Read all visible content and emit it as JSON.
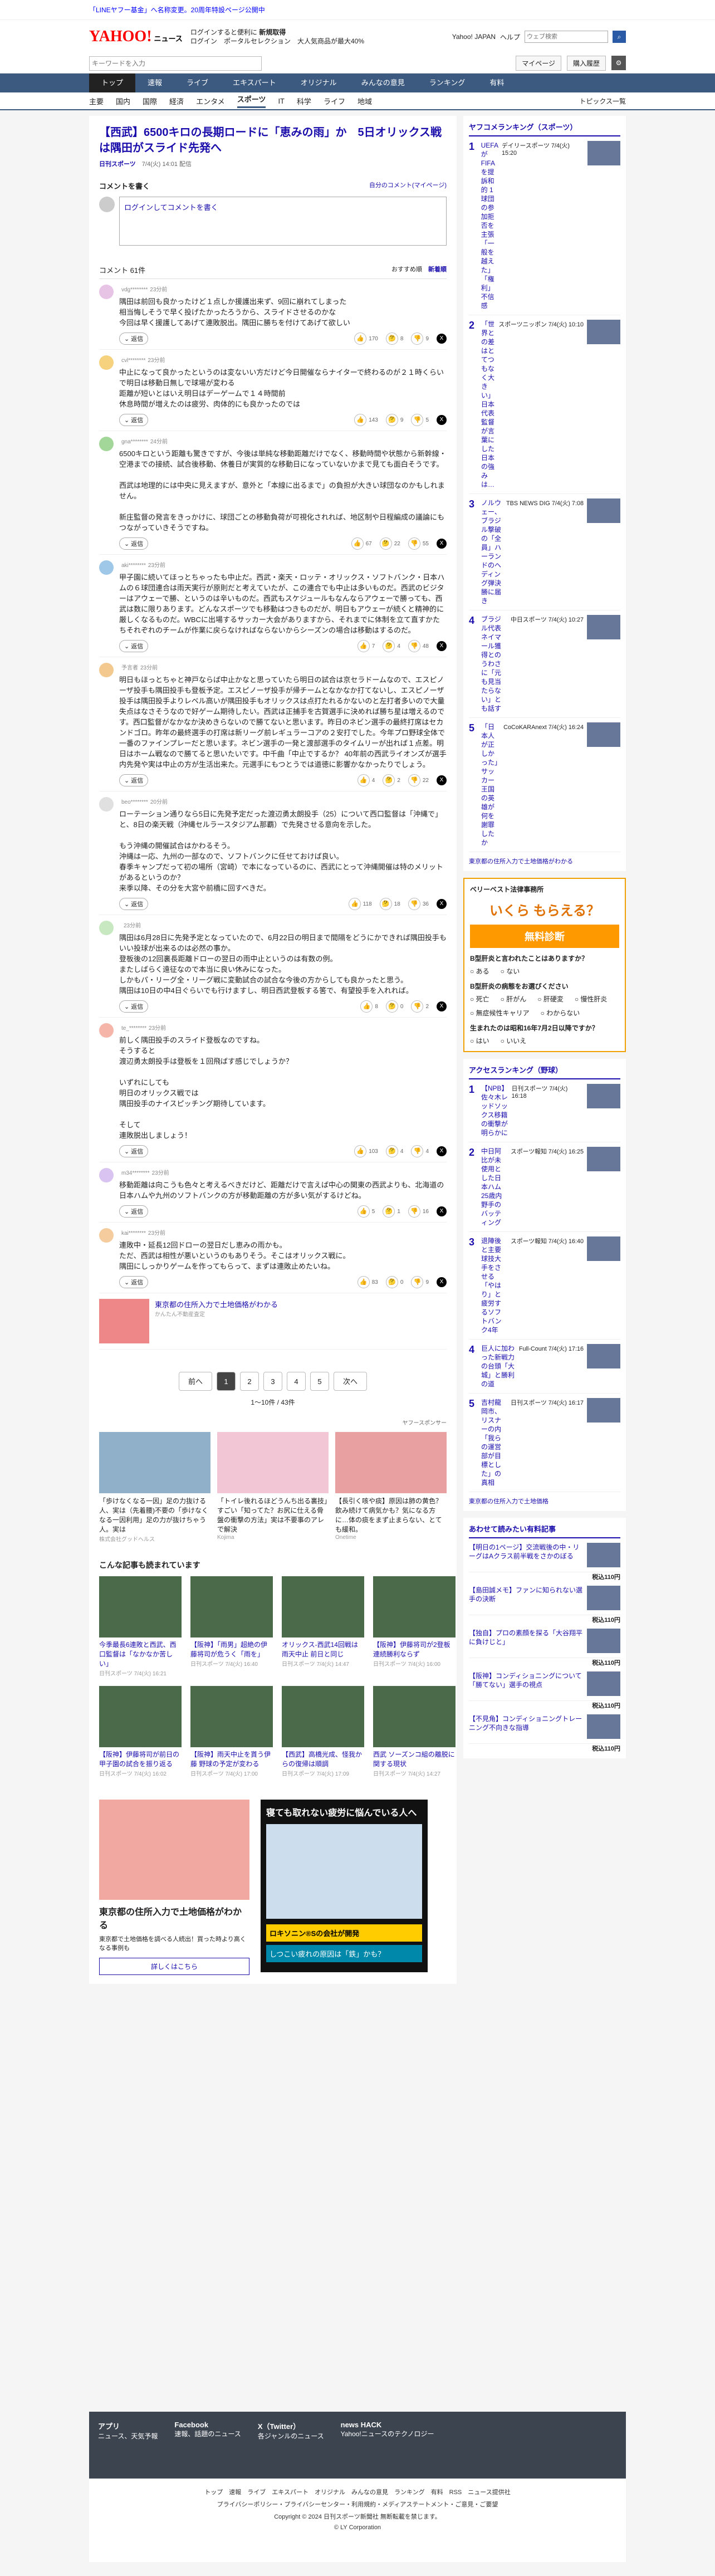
{
  "top_notice": "「LINEヤフー基金」へ名称変更。20周年特設ページ公開中",
  "header": {
    "logo": "YAHOO!",
    "logo_sub": "ニュース",
    "links": [
      "ログインすると便利に",
      "ログイン",
      "ポータルセレクション",
      "大人気商品が最大40%"
    ],
    "bold_link": "新規取得",
    "right": [
      "Yahoo! JAPAN",
      "ヘルプ"
    ],
    "search_placeholder": "ウェブ検索",
    "search_btn": "検索"
  },
  "searchrow": {
    "placeholder": "キーワードを入力",
    "mypage": "マイページ",
    "buy": "購入履歴"
  },
  "categories": [
    "トップ",
    "速報",
    "ライブ",
    "エキスパート",
    "オリジナル",
    "みんなの意見",
    "ランキング",
    "有料"
  ],
  "subnav": [
    "主要",
    "国内",
    "国際",
    "経済",
    "エンタメ",
    "スポーツ",
    "IT",
    "科学",
    "ライフ",
    "地域"
  ],
  "subnav_right": "トピックス一覧",
  "article": {
    "title": "【西武】6500キロの長期ロードに「恵みの雨」か　5日オリックス戦は隅田がスライド先発へ",
    "source": "日刊スポーツ",
    "date": "7/4(火) 14:01 配信"
  },
  "comment_write": {
    "label": "コメントを書く",
    "manage": "自分のコメント(マイページ)",
    "placeholder": "ログインしてコメントを書く"
  },
  "comment_head": {
    "count": "コメント 61件",
    "sort1": "おすすめ順",
    "sort2": "新着順"
  },
  "comments": [
    {
      "user": "vdg********",
      "time": "23分前",
      "text": "隅田は前回も良かったけど１点しか援護出来ず、9回に崩れてしまった\n相当悔しそうで早く投げたかったろうから、スライドさせるのかな\n今回は早く援護してあげて連敗脱出。隅田に勝ちを付けてあげて欲しい",
      "likes": "170",
      "neutral": "8",
      "dis": "9",
      "color": "#e7c3e5"
    },
    {
      "user": "cvl********",
      "time": "23分前",
      "text": "中止になって良かったというのは変ないい方だけど今日開催ならナイターで終わるのが２１時くらいで明日は移動日無しで球場が変わる\n距離が短いとはいえ明日はデーゲームで１４時間前\n休息時間が増えたのは疲労、肉体的にも良かったのでは",
      "likes": "143",
      "neutral": "9",
      "dis": "5",
      "color": "#f6d27e"
    },
    {
      "user": "gna********",
      "time": "24分前",
      "text": "6500キロという距離も驚きですが、今後は単純な移動距離だけでなく、移動時間や状態から新幹線・空港までの接続、試合後移動、休養日が実質的な移動日になっていないかまで見ても面白そうです。\n\n西武は地理的には中央に見えますが、意外と「本線に出るまで」の負担が大きい球団なのかもしれません。\n\n新庄監督の発言をきっかけに、球団ごとの移動負荷が可視化されれば、地区制や日程編成の議論にもつながっていきそうですね。",
      "likes": "67",
      "neutral": "22",
      "dis": "55",
      "color": "#a3d79a"
    },
    {
      "user": "aki********",
      "time": "23分前",
      "text": "甲子園に続いてほっとちゃったも中止だ。西武・楽天・ロッテ・オリックス・ソフトバンク・日本ハムの６球団連合は雨天実行が原則だと考えていたが、この連合でも中止は多いものだ。西武のビジターはアウェーで勝、というのは辛いものだ。西武もスケジュールもなんならアウェーで勝っても、西武は数に限りあります。どんなスポーツでも移動はつきものだが、明日もアウェーが続くと精神的に厳しくなるものだ。WBCに出場するサッカー大会がありますから、それまでに体制を立て直すかたちそれぞれのチームが作業に戻らなければならないからシーズンの場合は移動はするのだ。",
      "likes": "7",
      "neutral": "4",
      "dis": "48",
      "color": "#9fc8e8"
    },
    {
      "user": "予言者",
      "time": "23分前",
      "text": "明日もほっとちゃと神戸ならば中止かなと思っていたら明日の試合は京セラドームなので、エスピノーザ投手も隅田投手も登板予定。エスピノーザ投手が帰チームとなかなか打てないし、エスピノーザ投手は隅田投手よりレベル高いが隅田投手もオリックスは点打たれるかないのと左打者多いので大量失点はなさそうなので好ゲーム期待したい。西武は正捕手を古賀選手に決めれば勝ち星は増えるのです。西口監督がなかなか決めきらないので勝てないと思います。昨日のネビン選手の最終打席はセカンドゴロ。昨年の最終選手の打席は新リーグ前レギュラーコアの２安打でした。今年プロ野球全体で一番のファインプレーだと思います。ネビン選手の一発と渡部選手のタイムリーが出れば１点差。明日はホーム戦なので勝てると思いたいです。中千曲「中止でするか？ 40年前の西武ライオンズが選手内先発や実は中止の方が生活出来た。元選手にもつとうでは道徳に影響かなかったりでしょう。",
      "likes": "4",
      "neutral": "2",
      "dis": "22",
      "color": "#f3c98f"
    },
    {
      "user": "beo********",
      "time": "20分前",
      "text": "ローテーション通りなら5日に先発予定だった渡辺勇太朗投手（25）について西口監督は「沖縄で」と、8日の楽天戦（沖縄セルラースタジアム那覇）で先発させる意向を示した。\n\nもう沖縄の開催試合はかわるそう。\n沖縄は一応、九州の一部なので、ソフトバンクに任せておけば良い。\n春季キャンプだって初の場所（宮崎）で本になっているのに、西武にとって沖縄開催は特のメリットがあるというのか？\n来季以降、その分を大宮や前橋に回すべきだ。",
      "likes": "118",
      "neutral": "18",
      "dis": "36",
      "color": "#e0e0e0"
    },
    {
      "user": "",
      "time": "23分前",
      "text": "隅田は6月28日に先発予定となっていたので、6月22日の明日まで間隔をどうにかできれば隅田投手もいい投球が出来るのは必然の事か。\n登板後の12回裏長距離ドローの翌日の雨中止というのは有数の例。\nまたしばらく遠征なので本当に良い休みになった。\nしかもパ・リーグ全・リーグ戦に変動試合の試合な今後の方からしても良かったと思う。\n隅田は10日の中4日ぐらいでも行けますし、明日西武登板する筈で、有望投手を入れれば。",
      "likes": "8",
      "neutral": "0",
      "dis": "2",
      "color": "#c7e8c0"
    },
    {
      "user": "te_********",
      "time": "23分前",
      "text": "前しく隅田投手のスライド登板なのですね。\nそうすると\n渡辺勇太朗投手は登板を１回飛ばす感じでしょうか？\n\nいずれにしても\n明日のオリックス戦では\n隅田投手のナイスピッチング期待しています。\n\nそして\n連敗脱出しましょう！",
      "likes": "103",
      "neutral": "4",
      "dis": "4",
      "color": "#f6b5a9"
    },
    {
      "user": "m34********",
      "time": "23分前",
      "text": "移動距離は向こうも色々と考えるべきだけど、距離だけで言えば中心の関東の西武よりも、北海道の日本ハムや九州のソフトバンクの方が移動距離の方が多い気がするけどね。",
      "likes": "5",
      "neutral": "1",
      "dis": "16",
      "color": "#d9c3f0"
    },
    {
      "user": "kai********",
      "time": "23分前",
      "text": "連敗中・延長12回ドローの翌日だし恵みの雨かも。\nただ、西武は相性が悪いというのもありそう。そこはオリックス戦に。\n隅田にしっかりゲームを作ってもらって、まずは連敗止めたいね。",
      "likes": "83",
      "neutral": "0",
      "dis": "9",
      "color": "#f5cc9e"
    }
  ],
  "comment_ad": {
    "text": "東京都の住所入力で土地価格がわかる",
    "sub": "かんたん不動産査定"
  },
  "pager": {
    "prev": "前へ",
    "pages": [
      "1",
      "2",
      "3",
      "4",
      "5"
    ],
    "next": "次へ",
    "count": "1〜10件 / 43件"
  },
  "sponsor": "ヤフースポンサー",
  "ad3": [
    {
      "t": "「歩けなくなる一因」足の力抜ける人、実は（先着腰)不要の「歩けなくなる一因利用」足の力が抜けちゃう人。実は",
      "s": "株式会社グッドヘルス"
    },
    {
      "t": "「トイレ後れるほどうんち出る裏技」すごい「知ってた？お尻に仕える骨盤の衝撃の方法」実は不要事のアレで解決",
      "s": "Kojima"
    },
    {
      "t": "【長引く咳や痰】原因は肺の黄色？飲み続けて病気かも？気になる方に…体の痰をまず止まらない、とても緩和。",
      "s": "Onetime"
    }
  ],
  "reco_title": "こんな記事も読まれています",
  "reco": [
    {
      "t": "今季最長6連敗と西武、西口監督は「なかなか苦しい」",
      "s": "日刊スポーツ 7/4(火) 16:21"
    },
    {
      "t": "【阪神】「雨男」超絶の伊藤将司が危うく「雨を」",
      "s": "日刊スポーツ 7/4(火) 16:40"
    },
    {
      "t": "オリックス-西武14回戦は雨天中止 前日と同じ",
      "s": "日刊スポーツ 7/4(火) 14:47"
    },
    {
      "t": "【阪神】伊藤将司が2登板連続勝利ならず",
      "s": "日刊スポーツ 7/4(火) 16:00"
    },
    {
      "t": "【阪神】伊藤将司が前日の甲子園の試合を振り返る",
      "s": "日刊スポーツ 7/4(火) 16:02"
    },
    {
      "t": "【阪神】雨天中止を貰う伊藤 野球の予定が変わる",
      "s": "日刊スポーツ 7/4(火) 17:00"
    },
    {
      "t": "【西武】高橋光成、怪我からの復帰は順調",
      "s": "日刊スポーツ 7/4(火) 17:09"
    },
    {
      "t": "西武 ソーズンコ組の離脱に関する現状",
      "s": "日刊スポーツ 7/4(火) 14:27"
    }
  ],
  "bottom_ad": {
    "left_title": "東京都の住所入力で土地価格がわかる",
    "left_btn": "詳しくはこちら",
    "left_desc": "東京都で土地価格を調べる人続出！買った時より高くなる事例も",
    "right_title": "寝ても取れない疲労に悩んでいる人へ",
    "right_brand": "ロキソニン®Sの会社が開発",
    "right_cta": "しつこい疲れの原因は「鉄」かも？"
  },
  "side": {
    "rank_title": "ヤフコメランキング（スポーツ）",
    "ranking": [
      {
        "n": "1",
        "t": "UEFAがFIFAを提訴和的 1球団の参加拒否を主張「一般を越えた」「権利」不信感",
        "s": "デイリースポーツ 7/4(火) 15:20"
      },
      {
        "n": "2",
        "t": "「世界との差はとてつもなく大きい」日本代表監督が言葉にした日本の強みは…",
        "s": "スポーツニッポン 7/4(火) 10:10"
      },
      {
        "n": "3",
        "t": "ノルウェー、ブラジル撃破の「全員」ハーランドのヘディング弾決勝に届き",
        "s": "TBS NEWS DIG 7/4(火) 7:08"
      },
      {
        "n": "4",
        "t": "ブラジル代表ネイマール獲得とのうわさに「元も見当たらない」とも話す",
        "s": "中日スポーツ 7/4(火) 10:27"
      },
      {
        "n": "5",
        "t": "「日本人が正しかった」サッカー王国の英雄が何を謝罪したか",
        "s": "CoCoKARAnext 7/4(火) 16:24"
      }
    ],
    "pr": "東京都の住所入力で土地価格がわかる",
    "bigad": {
      "name": "ベリーベスト法律事務所",
      "catch": "いくら もらえる？",
      "cta": "無料診断",
      "q1": "B型肝炎と言われたことはありますか？",
      "o1": [
        "ある",
        "ない"
      ],
      "q2": "B型肝炎の病態をお選びください",
      "o2": [
        "死亡",
        "肝がん",
        "肝硬変",
        "慢性肝炎",
        "無症候性キャリア",
        "わからない"
      ],
      "q3": "生まれたのは昭和16年7月2日以降ですか？",
      "o3": [
        "はい",
        "いいえ"
      ]
    },
    "access_title": "アクセスランキング（野球）",
    "access": [
      {
        "n": "1",
        "t": "【NPB】佐々木レッドソックス移籍の衝撃が明らかに",
        "s": "日刊スポーツ 7/4(火) 16:18"
      },
      {
        "n": "2",
        "t": "中日阿比が未使用とした日本ハム25歳内野手のバッティング",
        "s": "スポーツ報知 7/4(火) 16:25"
      },
      {
        "n": "3",
        "t": "退陣後と主要球技大手をさせる「やはり」と疲労するソフトバンク4年",
        "s": "スポーツ報知 7/4(火) 16:40"
      },
      {
        "n": "4",
        "t": "巨人に加わった新戦力の台頭「大城」と勝利の道",
        "s": "Full-Count 7/4(火) 17:16"
      },
      {
        "n": "5",
        "t": "吉村龍岡市、リスナーの内「我らの運営部が目標とした」の真相",
        "s": "日刊スポーツ 7/4(火) 16:17"
      }
    ],
    "pr2": "東京都の住所入力で土地価格",
    "paid_title": "あわせて読みたい有料記事",
    "paid": [
      {
        "t": "【明日の1ページ】交流戦後の中・リーグはAクラス前半戦をさかのぼる",
        "p": "税込110円"
      },
      {
        "t": "【島田誠メモ】ファンに知られない選手の決断",
        "p": "税込110円"
      },
      {
        "t": "【独自】プロの素顔を探る「大谷翔平に負けじと」",
        "p": "税込110円"
      },
      {
        "t": "【阪神】コンディショニングについて「勝てない」選手の視点",
        "p": "税込110円"
      },
      {
        "t": "【不見角】コンディショニングトレーニング不向きな指導",
        "p": "税込110円"
      }
    ]
  },
  "footer": {
    "apps": [
      {
        "t": "アプリ",
        "d": "ニュース、天気予報"
      },
      {
        "t": "Facebook",
        "d": "速報、話題のニュース"
      },
      {
        "t": "X（Twitter）",
        "d": "各ジャンルのニュース"
      },
      {
        "t": "news HACK",
        "d": "Yahoo!ニュースのテクノロジー"
      }
    ],
    "links": "トップ　速報　ライブ　エキスパート　オリジナル　みんなの意見　ランキング　有料　RSS　ニュース提供社",
    "legal": "プライバシーポリシー・プライバシーセンター・利用規約・メディアステートメント・ご意見・ご要望",
    "copyright": "Copyright © 2024 日刊スポーツ新聞社 無断転載を禁じます。",
    "copyright2": "© LY Corporation"
  }
}
